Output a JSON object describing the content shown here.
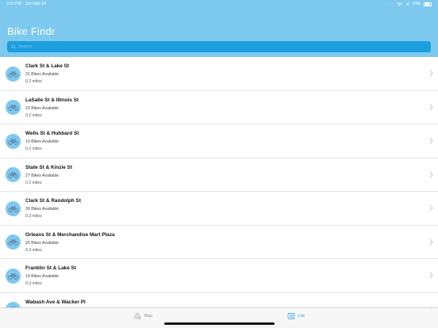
{
  "status_bar": {
    "time": "9:15 PM",
    "date": "Sun Mar 24",
    "battery": "41%"
  },
  "header": {
    "title": "Bike Findr"
  },
  "search": {
    "placeholder": "Search"
  },
  "stations": [
    {
      "name": "Clark St & Lake St",
      "bikes": "22 Bikes Available",
      "distance": "0.2 miles"
    },
    {
      "name": "LaSalle St & Illinois St",
      "bikes": "23 Bikes Available",
      "distance": "0.2 miles"
    },
    {
      "name": "Wells St & Hubbard St",
      "bikes": "19 Bikes Available",
      "distance": "0.2 miles"
    },
    {
      "name": "State St & Kinzie St",
      "bikes": "27 Bikes Available",
      "distance": "0.2 miles"
    },
    {
      "name": "Clark St & Randolph St",
      "bikes": "30 Bikes Available",
      "distance": "0.3 miles"
    },
    {
      "name": "Orleans St & Merchandise Mart Plaza",
      "bikes": "25 Bikes Available",
      "distance": "0.3 miles"
    },
    {
      "name": "Franklin St & Lake St",
      "bikes": "19 Bikes Available",
      "distance": "0.3 miles"
    },
    {
      "name": "Wabash Ave & Wacker Pl",
      "bikes": "",
      "distance": ""
    }
  ],
  "tabs": {
    "map": "Map",
    "list": "List"
  },
  "colors": {
    "header_bg": "#7dc9ef",
    "search_bg": "#1b9ede",
    "accent": "#1b9ede",
    "avatar_bg": "#7dc9ef",
    "avatar_icon": "#5a6b8c"
  }
}
